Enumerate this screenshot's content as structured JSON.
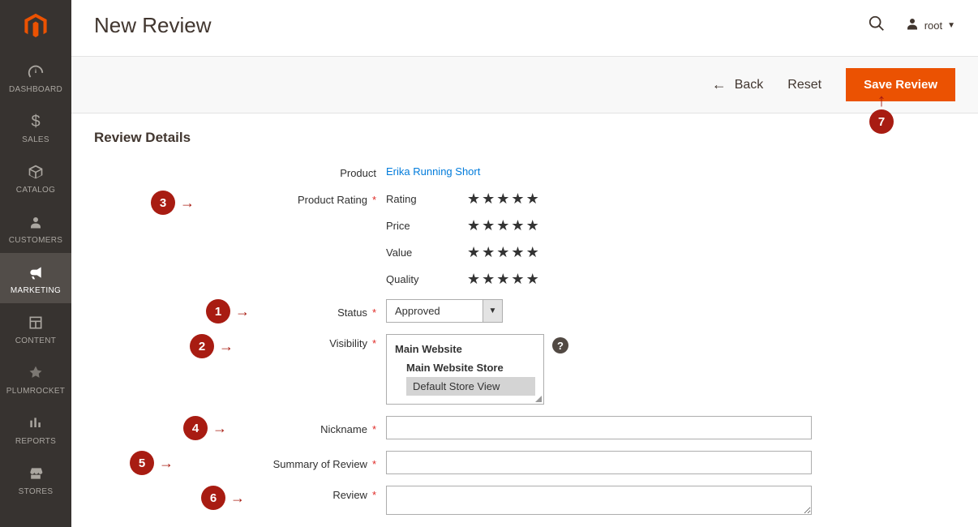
{
  "header": {
    "title": "New Review",
    "user": "root"
  },
  "actions": {
    "back": "Back",
    "reset": "Reset",
    "save": "Save Review"
  },
  "sidebar": {
    "items": [
      {
        "label": "DASHBOARD"
      },
      {
        "label": "SALES"
      },
      {
        "label": "CATALOG"
      },
      {
        "label": "CUSTOMERS"
      },
      {
        "label": "MARKETING"
      },
      {
        "label": "CONTENT"
      },
      {
        "label": "PLUMROCKET"
      },
      {
        "label": "REPORTS"
      },
      {
        "label": "STORES"
      }
    ]
  },
  "form": {
    "section_title": "Review Details",
    "product_label": "Product",
    "product_name": "Erika Running Short",
    "rating_label": "Product Rating",
    "ratings": [
      {
        "label": "Rating"
      },
      {
        "label": "Price"
      },
      {
        "label": "Value"
      },
      {
        "label": "Quality"
      }
    ],
    "status_label": "Status",
    "status_value": "Approved",
    "visibility_label": "Visibility",
    "visibility": {
      "website": "Main Website",
      "store": "Main Website Store",
      "view": "Default Store View"
    },
    "nickname_label": "Nickname",
    "nickname_value": "",
    "summary_label": "Summary of Review",
    "summary_value": "",
    "review_label": "Review",
    "review_value": ""
  },
  "callouts": {
    "c1": "1",
    "c2": "2",
    "c3": "3",
    "c4": "4",
    "c5": "5",
    "c6": "6",
    "c7": "7"
  }
}
